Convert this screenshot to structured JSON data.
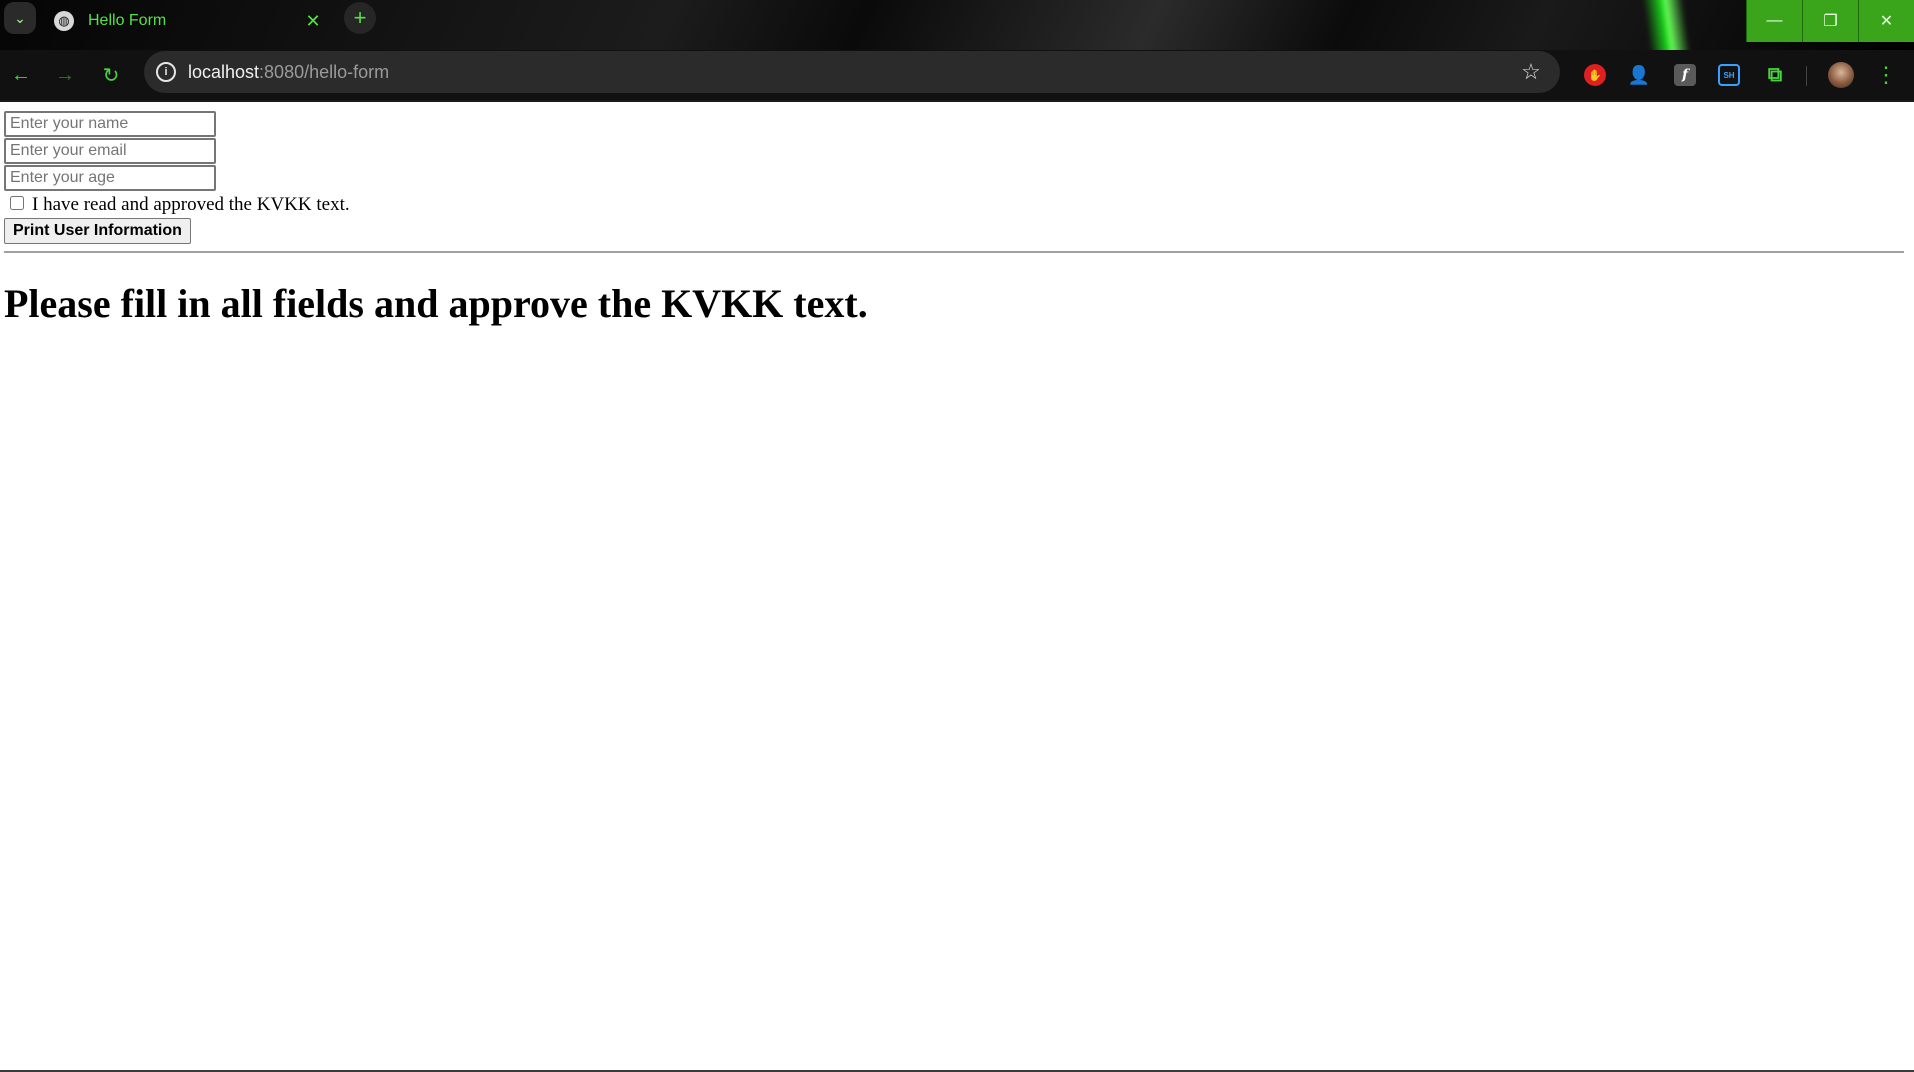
{
  "browser": {
    "tab": {
      "title": "Hello Form",
      "favicon_icon": "globe-icon",
      "close_icon": "close-icon"
    },
    "tab_search_icon": "chevron-down-icon",
    "new_tab_icon": "plus-icon",
    "window_controls": [
      "minimize-icon",
      "restore-icon",
      "close-icon"
    ],
    "address_bar": {
      "host": "localhost",
      "path": ":8080/hello-form"
    },
    "accent_color": "#47d63a",
    "window_control_color": "#3aa51a"
  },
  "form": {
    "name_placeholder": "Enter your name",
    "email_placeholder": "Enter your email",
    "age_placeholder": "Enter your age",
    "kvkk_label": "I have read and approved the KVKK text.",
    "kvkk_checked": false,
    "submit_label": "Print User Information"
  },
  "result": {
    "message": "Please fill in all fields and approve the KVKK text."
  }
}
